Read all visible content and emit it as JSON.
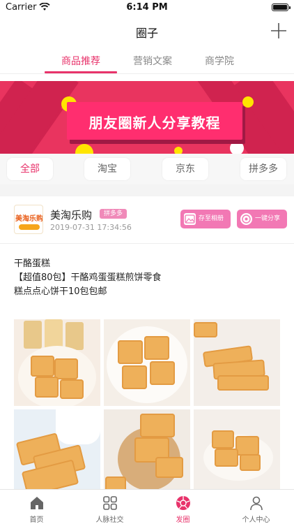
{
  "status_bar": {
    "carrier": "Carrier",
    "time": "6:14 PM"
  },
  "nav": {
    "title": "圈子",
    "add_icon": "plus-icon"
  },
  "segment_tabs": [
    {
      "label": "商品推荐",
      "active": true
    },
    {
      "label": "营销文案",
      "active": false
    },
    {
      "label": "商学院",
      "active": false
    }
  ],
  "banner": {
    "text": "朋友圈新人分享教程"
  },
  "filters": [
    {
      "label": "全部",
      "active": true
    },
    {
      "label": "淘宝",
      "active": false
    },
    {
      "label": "京东",
      "active": false
    },
    {
      "label": "拼多多",
      "active": false
    }
  ],
  "post": {
    "avatar_text": "美淘乐购",
    "shop_name": "美淘乐购",
    "platform": "拼多多",
    "time": "2019-07-31 17:34:56",
    "save_label": "存至相册",
    "share_label": "一键分享",
    "lines": [
      "干酪蛋糕",
      "【超值80包】干酪鸡蛋蛋糕煎饼零食",
      "糕点点心饼干10包包邮"
    ],
    "photos": [
      "cake-package-photo",
      "cake-plate-photo",
      "cake-stack-photo",
      "cake-wheat-photo",
      "cake-board-photo",
      "cake-dish-photo"
    ]
  },
  "tab_bar": [
    {
      "label": "首页",
      "icon": "home-icon",
      "active": false
    },
    {
      "label": "人脉社交",
      "icon": "grid-icon",
      "active": false
    },
    {
      "label": "发圈",
      "icon": "aperture-icon",
      "active": true
    },
    {
      "label": "个人中心",
      "icon": "person-icon",
      "active": false
    }
  ],
  "colors": {
    "accent": "#e8336b",
    "banner": "#e9345f",
    "button": "#f278b4"
  }
}
